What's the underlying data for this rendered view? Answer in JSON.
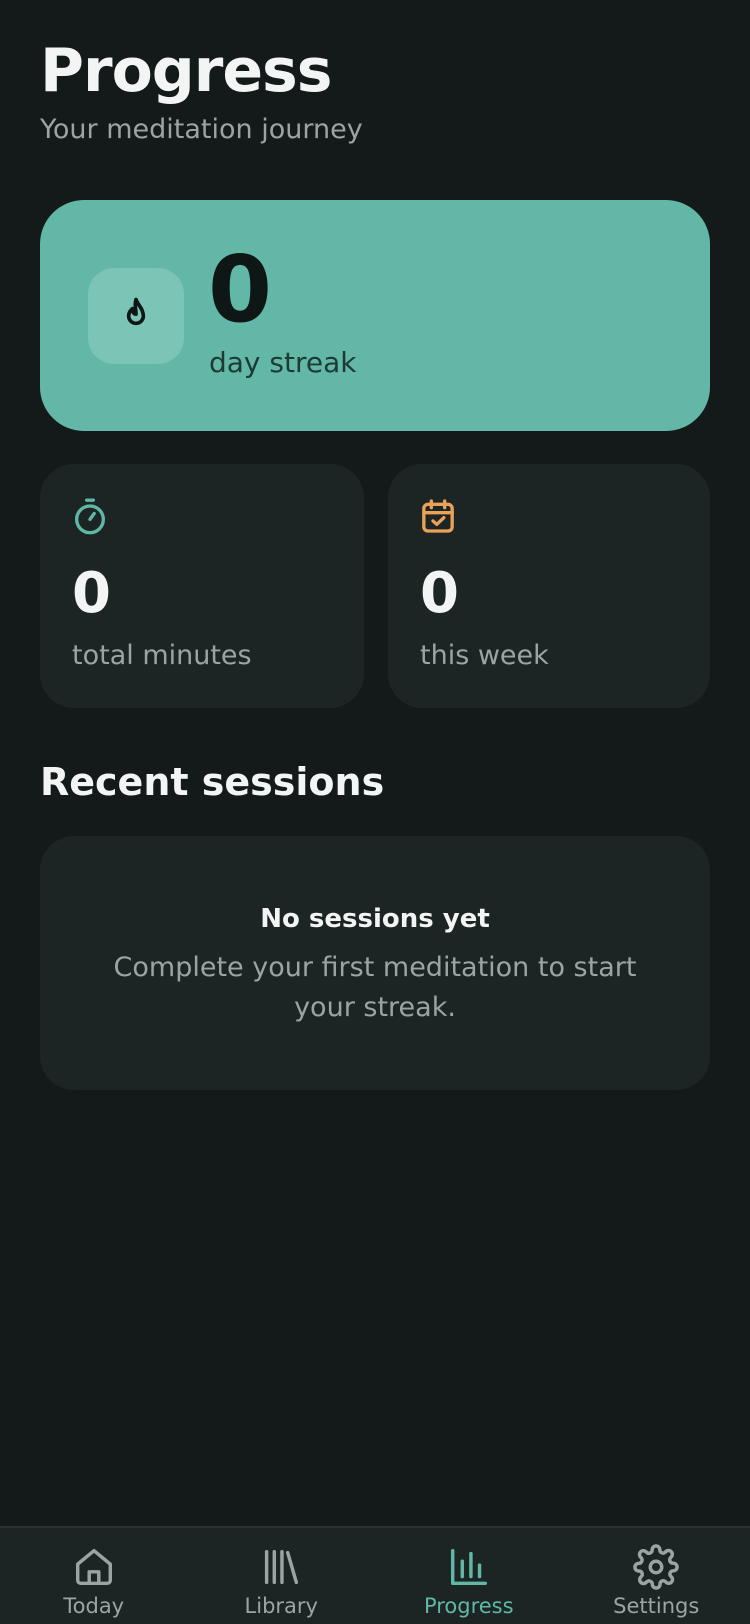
{
  "header": {
    "title": "Progress",
    "subtitle": "Your meditation journey"
  },
  "streak": {
    "value": "0",
    "label": "day streak",
    "icon": "flame-icon",
    "card_color": "#62b7a6"
  },
  "stats": [
    {
      "value": "0",
      "label": "total minutes",
      "icon": "stopwatch-icon",
      "icon_color": "#5fb8a6"
    },
    {
      "value": "0",
      "label": "this week",
      "icon": "calendar-check-icon",
      "icon_color": "#e8a25a"
    }
  ],
  "recent": {
    "title": "Recent sessions",
    "empty_title": "No sessions yet",
    "empty_text": "Complete your first meditation to start your streak."
  },
  "tabbar": {
    "active": "Progress",
    "active_color": "#5fb8a6",
    "items": [
      {
        "label": "Today",
        "icon": "home-icon"
      },
      {
        "label": "Library",
        "icon": "library-icon"
      },
      {
        "label": "Progress",
        "icon": "bar-chart-icon"
      },
      {
        "label": "Settings",
        "icon": "gear-icon"
      }
    ]
  }
}
